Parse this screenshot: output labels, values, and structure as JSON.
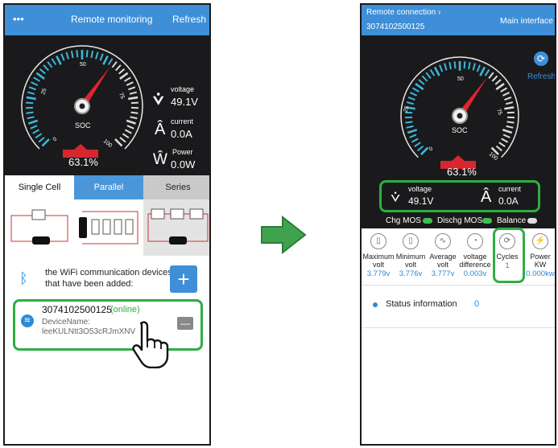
{
  "left": {
    "header": {
      "menu": "•••",
      "title": "Remote monitoring",
      "refresh": "Refresh"
    },
    "gauge": {
      "ticks": [
        "0",
        "25",
        "50",
        "75",
        "100"
      ],
      "label": "SOC",
      "percent": "63.1%",
      "value": 0.631
    },
    "readings": [
      {
        "label": "voltage",
        "value": "49.1V"
      },
      {
        "label": "current",
        "value": "0.0A"
      },
      {
        "label": "Power",
        "value": "0.0W"
      }
    ],
    "tabs": [
      "Single Cell",
      "Parallel",
      "Series"
    ],
    "devices_text": "the WiFi communication devices that have been added:",
    "device": {
      "id": "3074102500125",
      "status": "(online)",
      "name_label": "DeviceName:",
      "name_value": "leeKULNtt3O53cRJmXNV"
    },
    "add_symbol": "+",
    "remove_symbol": "—"
  },
  "right": {
    "header": {
      "connection": "Remote connection",
      "device_id": "3074102500125",
      "main": "Main interface"
    },
    "refresh": "Refresh",
    "gauge": {
      "ticks": [
        "0",
        "25",
        "50",
        "75",
        "100"
      ],
      "label": "SOC",
      "percent": "63.1%",
      "value": 0.631
    },
    "readings": [
      {
        "label": "voltage",
        "value": "49.1V"
      },
      {
        "label": "current",
        "value": "0.0A"
      }
    ],
    "toggles": [
      {
        "label": "Chg MOS",
        "on": true
      },
      {
        "label": "Dischg MOS",
        "on": true
      },
      {
        "label": "Balance",
        "on": false
      }
    ],
    "metrics": [
      {
        "label": "Maximum volt",
        "value": "3.779v"
      },
      {
        "label": "Minimum volt",
        "value": "3.776v"
      },
      {
        "label": "Average volt",
        "value": "3.777v"
      },
      {
        "label": "voltage difference",
        "value": "0.003v"
      },
      {
        "label": "Cycles",
        "value": "1"
      },
      {
        "label": "Power KW",
        "value": "0.000kw"
      }
    ],
    "status": {
      "label": "Status information",
      "count": "0"
    }
  },
  "colors": {
    "header": "#3e8fd8",
    "dark": "#1a1a1c",
    "green": "#2eae43",
    "needle": "#e0242e",
    "accent": "#2a8ad8"
  }
}
